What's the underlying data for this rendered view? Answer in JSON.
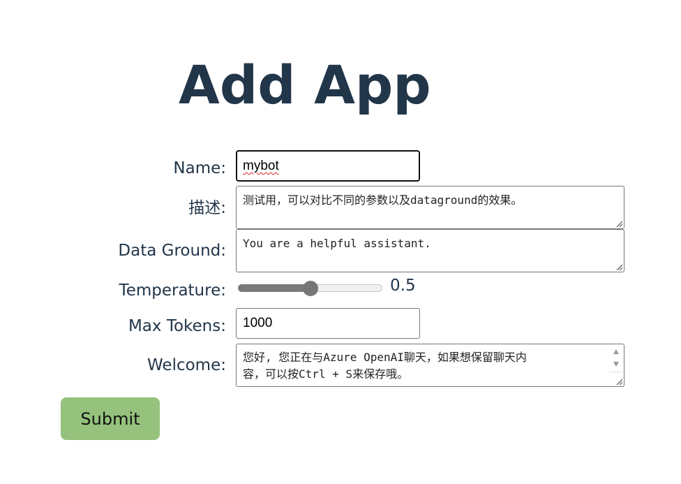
{
  "page": {
    "title": "Add App"
  },
  "form": {
    "name": {
      "label": "Name:",
      "value": "mybot"
    },
    "description": {
      "label": "描述:",
      "value": "测试用，可以对比不同的参数以及dataground的效果。"
    },
    "data_ground": {
      "label": "Data Ground:",
      "value": "You are a helpful assistant."
    },
    "temperature": {
      "label": "Temperature:",
      "value": 0.5,
      "value_text": "0.5",
      "min": 0,
      "max": 1
    },
    "max_tokens": {
      "label": "Max Tokens:",
      "value": "1000"
    },
    "welcome": {
      "label": "Welcome:",
      "line1": "您好, 您正在与Azure OpenAI聊天，如果想保留聊天内",
      "line2": "容，可以按Ctrl + S来保存哦。"
    },
    "submit_label": "Submit"
  },
  "colors": {
    "title": "#22364a",
    "submit_bg": "#95c27c",
    "slider_thumb": "#767676"
  },
  "icons": {
    "resize": "resize-grip-icon",
    "scroll_up": "scroll-up-arrow-icon",
    "scroll_down": "scroll-down-arrow-icon"
  }
}
